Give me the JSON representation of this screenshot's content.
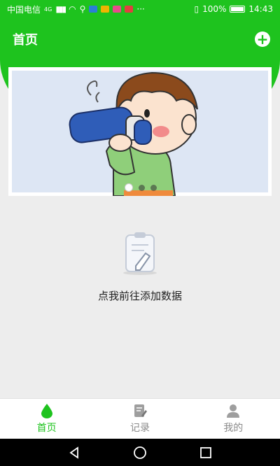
{
  "statusbar": {
    "carrier": "中国电信",
    "network": "4G",
    "battery": "100%",
    "time": "14:43"
  },
  "header": {
    "title": "首页",
    "add_icon": "plus-circle-icon"
  },
  "banner": {
    "illustration": "boy drinking from blue bottle",
    "pages": 3,
    "active_page": 1
  },
  "empty_state": {
    "message": "点我前往添加数据",
    "icon": "clipboard-pen-icon"
  },
  "tabbar": {
    "tabs": [
      {
        "label": "首页",
        "icon": "water-drop-icon",
        "active": true
      },
      {
        "label": "记录",
        "icon": "edit-document-icon",
        "active": false
      },
      {
        "label": "我的",
        "icon": "user-icon",
        "active": false
      }
    ]
  },
  "colors": {
    "accent": "#1ec31e",
    "background": "#ededed"
  }
}
